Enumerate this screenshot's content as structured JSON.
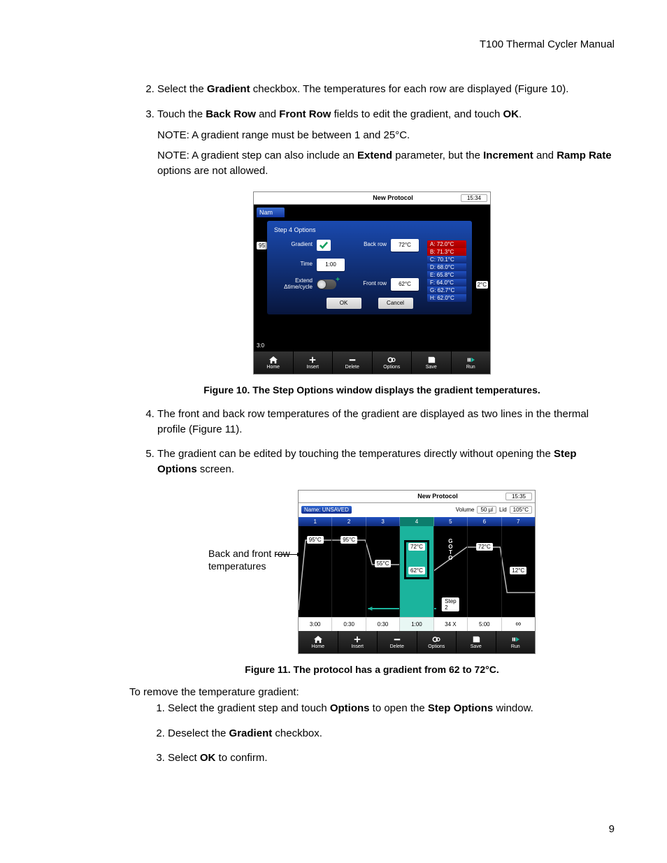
{
  "header": {
    "title": "T100 Thermal Cycler Manual"
  },
  "page_number": "9",
  "steps_top": [
    {
      "num": "2",
      "prefix": "Select the ",
      "bold1": "Gradient",
      "mid": " checkbox. The temperatures for each row are displayed (Figure 10)."
    },
    {
      "num": "3"
    }
  ],
  "step3": {
    "prefix": "Touch the ",
    "b1": "Back Row",
    "mid1": " and ",
    "b2": "Front Row",
    "mid2": " fields to edit the gradient, and touch ",
    "b3": "OK",
    "tail": ".",
    "note1": "NOTE: A gradient range must be between 1 and 25°C.",
    "note2_pre": "NOTE: A gradient step can also include an ",
    "note2_b1": "Extend",
    "note2_mid": " parameter, but the ",
    "note2_b2": "Increment",
    "note2_mid2": " and ",
    "note2_b3": "Ramp Rate",
    "note2_tail": " options are not allowed."
  },
  "caption10": "Figure 10. The Step Options window displays the gradient temperatures.",
  "steps_mid": {
    "s4": "The front and back row temperatures of the gradient are displayed as two lines in the thermal profile (Figure 11).",
    "s5_pre": "The gradient can be edited by touching the temperatures directly without opening the ",
    "s5_b": "Step Options",
    "s5_tail": " screen."
  },
  "callout11": "Back and front row temperatures",
  "caption11": "Figure 11. The protocol has a gradient from 62 to 72°C.",
  "removal_intro": "To remove the temperature gradient:",
  "removal": {
    "r1_pre": "Select the gradient step and touch ",
    "r1_b1": "Options",
    "r1_mid": " to open the ",
    "r1_b2": "Step Options",
    "r1_tail": " window.",
    "r2_pre": "Deselect the ",
    "r2_b": "Gradient",
    "r2_tail": " checkbox.",
    "r3_pre": "Select ",
    "r3_b": "OK",
    "r3_tail": " to confirm."
  },
  "fig10": {
    "title": "New Protocol",
    "clock": "15:34",
    "name_stub": "Nam",
    "popup_title": "Step 4 Options",
    "gradient_label": "Gradient",
    "time_label": "Time",
    "time_val": "1:00",
    "extend_l1": "Extend",
    "extend_l2": "Δtime/cycle",
    "back_row_label": "Back row",
    "back_row_val": "72°C",
    "front_row_label": "Front row",
    "front_row_val": "62°C",
    "ok": "OK",
    "cancel": "Cancel",
    "side95": "95",
    "sideC": "2°C",
    "side3": "3:0",
    "grad_rows": [
      "A: 72.0°C",
      "B: 71.3°C",
      "C: 70.1°C",
      "D: 68.0°C",
      "E: 65.8°C",
      "F: 64.0°C",
      "G: 62.7°C",
      "H: 62.0°C"
    ]
  },
  "toolbar": {
    "home": "Home",
    "insert": "Insert",
    "delete": "Delete",
    "options": "Options",
    "save": "Save",
    "run": "Run"
  },
  "fig11": {
    "title": "New Protocol",
    "clock": "15:35",
    "name_label": "Name: UNSAVED",
    "volume_label": "Volume",
    "volume_val": "50 µl",
    "lid_label": "Lid",
    "lid_val": "105°C",
    "steps": [
      "1",
      "2",
      "3",
      "4",
      "5",
      "6",
      "7"
    ],
    "temps": {
      "c1": "95°C",
      "c2": "95°C",
      "c3": "55°C",
      "c4a": "72°C",
      "c4b": "62°C",
      "c6": "72°C",
      "c7": "12°C"
    },
    "goto_vert": "GOTO",
    "goto_step": "Step 2",
    "times": [
      "3:00",
      "0:30",
      "0:30",
      "1:00",
      "34 X",
      "5:00",
      "∞"
    ]
  }
}
